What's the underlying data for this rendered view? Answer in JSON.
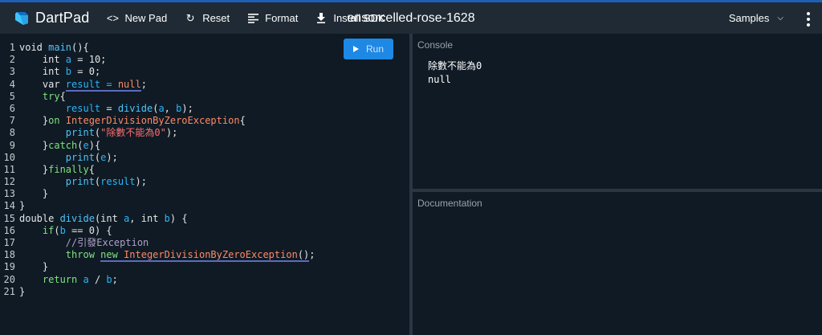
{
  "header": {
    "logo_text": "DartPad",
    "new_pad": "New Pad",
    "reset": "Reset",
    "format": "Format",
    "install_sdk": "Install SDK",
    "title": "ensorcelled-rose-1628",
    "samples": "Samples"
  },
  "editor": {
    "run_label": "Run",
    "lines": [
      {
        "n": "1",
        "tokens": [
          {
            "t": "void ",
            "c": "plain"
          },
          {
            "t": "main",
            "c": "fn"
          },
          {
            "t": "(){",
            "c": "plain"
          }
        ]
      },
      {
        "n": "2",
        "tokens": [
          {
            "t": "    int ",
            "c": "plain"
          },
          {
            "t": "a",
            "c": "kw"
          },
          {
            "t": " = ",
            "c": "plain"
          },
          {
            "t": "10",
            "c": "num"
          },
          {
            "t": ";",
            "c": "plain"
          }
        ]
      },
      {
        "n": "3",
        "tokens": [
          {
            "t": "    int ",
            "c": "plain"
          },
          {
            "t": "b",
            "c": "kw"
          },
          {
            "t": " = ",
            "c": "plain"
          },
          {
            "t": "0",
            "c": "num"
          },
          {
            "t": ";",
            "c": "plain"
          }
        ]
      },
      {
        "n": "4",
        "tokens": [
          {
            "t": "    var ",
            "c": "plain"
          },
          {
            "t": "result = ",
            "c": "kw",
            "u": true
          },
          {
            "t": "null",
            "c": "type",
            "u": true
          },
          {
            "t": ";",
            "c": "plain"
          }
        ]
      },
      {
        "n": "5",
        "tokens": [
          {
            "t": "    try",
            "c": "ctrl"
          },
          {
            "t": "{",
            "c": "plain"
          }
        ]
      },
      {
        "n": "6",
        "tokens": [
          {
            "t": "        result",
            "c": "kw"
          },
          {
            "t": " = ",
            "c": "plain"
          },
          {
            "t": "divide",
            "c": "fn"
          },
          {
            "t": "(",
            "c": "plain"
          },
          {
            "t": "a",
            "c": "kw"
          },
          {
            "t": ", ",
            "c": "plain"
          },
          {
            "t": "b",
            "c": "kw"
          },
          {
            "t": ");",
            "c": "plain"
          }
        ]
      },
      {
        "n": "7",
        "tokens": [
          {
            "t": "    }",
            "c": "plain"
          },
          {
            "t": "on ",
            "c": "ctrl"
          },
          {
            "t": "IntegerDivisionByZeroException",
            "c": "type"
          },
          {
            "t": "{",
            "c": "plain"
          }
        ]
      },
      {
        "n": "8",
        "tokens": [
          {
            "t": "        print",
            "c": "fn"
          },
          {
            "t": "(",
            "c": "plain"
          },
          {
            "t": "\"除數不能為0\"",
            "c": "str"
          },
          {
            "t": ");",
            "c": "plain"
          }
        ]
      },
      {
        "n": "9",
        "tokens": [
          {
            "t": "    }",
            "c": "plain"
          },
          {
            "t": "catch",
            "c": "ctrl"
          },
          {
            "t": "(",
            "c": "plain"
          },
          {
            "t": "e",
            "c": "kw"
          },
          {
            "t": "){",
            "c": "plain"
          }
        ]
      },
      {
        "n": "10",
        "tokens": [
          {
            "t": "        print",
            "c": "fn"
          },
          {
            "t": "(",
            "c": "plain"
          },
          {
            "t": "e",
            "c": "kw"
          },
          {
            "t": ");",
            "c": "plain"
          }
        ]
      },
      {
        "n": "11",
        "tokens": [
          {
            "t": "    }",
            "c": "plain"
          },
          {
            "t": "finally",
            "c": "ctrl"
          },
          {
            "t": "{",
            "c": "plain"
          }
        ]
      },
      {
        "n": "12",
        "tokens": [
          {
            "t": "        print",
            "c": "fn"
          },
          {
            "t": "(",
            "c": "plain"
          },
          {
            "t": "result",
            "c": "kw"
          },
          {
            "t": ");",
            "c": "plain"
          }
        ]
      },
      {
        "n": "13",
        "tokens": [
          {
            "t": "    }",
            "c": "plain"
          }
        ]
      },
      {
        "n": "14",
        "tokens": [
          {
            "t": "}",
            "c": "plain"
          }
        ]
      },
      {
        "n": "15",
        "tokens": [
          {
            "t": "double ",
            "c": "plain"
          },
          {
            "t": "divide",
            "c": "fn"
          },
          {
            "t": "(int ",
            "c": "plain"
          },
          {
            "t": "a",
            "c": "kw"
          },
          {
            "t": ", int ",
            "c": "plain"
          },
          {
            "t": "b",
            "c": "kw"
          },
          {
            "t": ") {",
            "c": "plain"
          }
        ]
      },
      {
        "n": "16",
        "tokens": [
          {
            "t": "    if",
            "c": "ctrl"
          },
          {
            "t": "(",
            "c": "plain"
          },
          {
            "t": "b",
            "c": "kw"
          },
          {
            "t": " == ",
            "c": "plain"
          },
          {
            "t": "0",
            "c": "num"
          },
          {
            "t": ") {",
            "c": "plain"
          }
        ]
      },
      {
        "n": "17",
        "tokens": [
          {
            "t": "        //引發Exception",
            "c": "cmt"
          }
        ]
      },
      {
        "n": "18",
        "tokens": [
          {
            "t": "        throw ",
            "c": "ctrl"
          },
          {
            "t": "new ",
            "c": "ctrl",
            "u": true
          },
          {
            "t": "IntegerDivisionByZeroException",
            "c": "type",
            "u": true
          },
          {
            "t": "()",
            "c": "plain",
            "u": true
          },
          {
            "t": ";",
            "c": "plain"
          }
        ]
      },
      {
        "n": "19",
        "tokens": [
          {
            "t": "    }",
            "c": "plain"
          }
        ]
      },
      {
        "n": "20",
        "tokens": [
          {
            "t": "    return ",
            "c": "ctrl"
          },
          {
            "t": "a",
            "c": "kw"
          },
          {
            "t": " / ",
            "c": "plain"
          },
          {
            "t": "b",
            "c": "kw"
          },
          {
            "t": ";",
            "c": "plain"
          }
        ]
      },
      {
        "n": "21",
        "tokens": [
          {
            "t": "}",
            "c": "plain"
          }
        ]
      }
    ]
  },
  "console": {
    "label": "Console",
    "output": [
      "除數不能為0",
      "null"
    ]
  },
  "documentation": {
    "label": "Documentation"
  },
  "colors": {
    "accent": "#1e88e5",
    "background": "#0f1a24",
    "header": "#1f2a34"
  },
  "icons": {
    "logo": "dart-logo-icon",
    "new_pad": "code-brackets-icon",
    "reset": "refresh-icon",
    "format": "format-align-icon",
    "install_sdk": "download-icon",
    "samples": "chevron-down-icon",
    "more": "kebab-menu-icon",
    "run": "play-icon"
  }
}
